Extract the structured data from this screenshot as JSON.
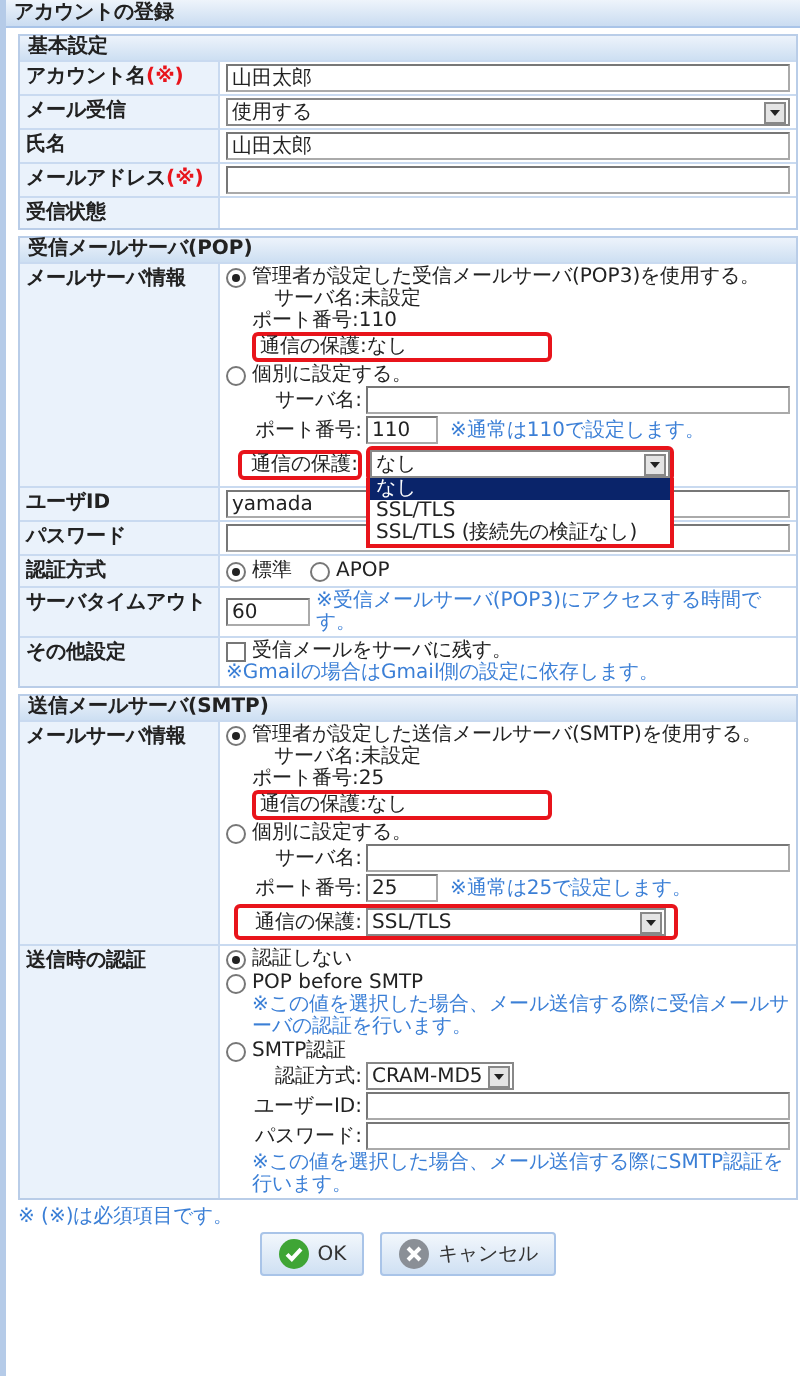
{
  "title": "アカウントの登録",
  "sections": [
    {
      "heading": "基本設定",
      "rows": [
        {
          "label": "アカウント名",
          "required_mark": "(※)",
          "kind": "text",
          "value": "山田太郎"
        },
        {
          "label": "メール受信",
          "kind": "select",
          "value": "使用する"
        },
        {
          "label": "氏名",
          "kind": "text",
          "value": "山田太郎"
        },
        {
          "label": "メールアドレス",
          "required_mark": "(※)",
          "kind": "text"
        },
        {
          "label": "受信状態",
          "kind": "empty"
        }
      ]
    },
    {
      "heading": "受信メールサーバ(POP)",
      "rows": [
        {
          "label": "メールサーバ情報",
          "kind": "server",
          "admin_option": {
            "label": "管理者が設定した受信メールサーバ(POP3)を使用する。",
            "selected": true,
            "server_name": "サーバ名:未設定",
            "port": "ポート番号:110",
            "protection": "通信の保護:なし",
            "highlighted": true
          },
          "custom_option": {
            "label": "個別に設定する。",
            "selected": false,
            "server_name_label": "サーバ名:",
            "port_label": "ポート番号:",
            "port_value": "110",
            "port_note": "※通常は110で設定します。",
            "protection_label": "通信の保護:",
            "protection_value": "なし",
            "highlighted": true,
            "dropdown_open": true,
            "options": [
              {
                "label": "なし",
                "selected": true
              },
              {
                "label": "SSL/TLS",
                "selected": false
              },
              {
                "label": "SSL/TLS (接続先の検証なし)",
                "selected": false
              }
            ]
          }
        },
        {
          "label": "ユーザID",
          "kind": "text",
          "value": "yamada"
        },
        {
          "label": "パスワード",
          "kind": "text"
        },
        {
          "label": "認証方式",
          "kind": "radios",
          "options": [
            {
              "label": "標準",
              "selected": true
            },
            {
              "label": "APOP",
              "selected": false
            }
          ]
        },
        {
          "label": "サーバタイムアウト",
          "kind": "short_text",
          "value": "60",
          "note": "※受信メールサーバ(POP3)にアクセスする時間です。"
        },
        {
          "label": "その他設定",
          "kind": "checkbox",
          "checkbox": {
            "label": "受信メールをサーバに残す。",
            "checked": false
          },
          "note": "※Gmailの場合はGmail側の設定に依存します。"
        }
      ]
    },
    {
      "heading": "送信メールサーバ(SMTP)",
      "rows": [
        {
          "label": "メールサーバ情報",
          "kind": "server",
          "admin_option": {
            "label": "管理者が設定した送信メールサーバ(SMTP)を使用する。",
            "selected": true,
            "server_name": "サーバ名:未設定",
            "port": "ポート番号:25",
            "protection": "通信の保護:なし",
            "highlighted": true
          },
          "custom_option": {
            "label": "個別に設定する。",
            "selected": false,
            "server_name_label": "サーバ名:",
            "port_label": "ポート番号:",
            "port_value": "25",
            "port_note": "※通常は25で設定します。",
            "protection_label": "通信の保護:",
            "protection_value": "SSL/TLS",
            "highlighted": true,
            "dropdown_open": false
          }
        },
        {
          "label": "送信時の認証",
          "kind": "auth",
          "options": [
            {
              "label": "認証しない",
              "selected": true
            },
            {
              "label": "POP before SMTP",
              "selected": false,
              "note": "※この値を選択した場合、メール送信する際に受信メールサーバの認証を行います。"
            },
            {
              "label": "SMTP認証",
              "selected": false,
              "method_label": "認証方式:",
              "method_value": "CRAM-MD5",
              "user_label": "ユーザーID:",
              "password_label": "パスワード:",
              "note": "※この値を選択した場合、メール送信する際にSMTP認証を行います。"
            }
          ]
        }
      ]
    }
  ],
  "footnote": "※ (※)は必須項目です。",
  "buttons": [
    {
      "label": "OK",
      "kind": "ok"
    },
    {
      "label": "キャンセル",
      "kind": "cancel"
    }
  ]
}
